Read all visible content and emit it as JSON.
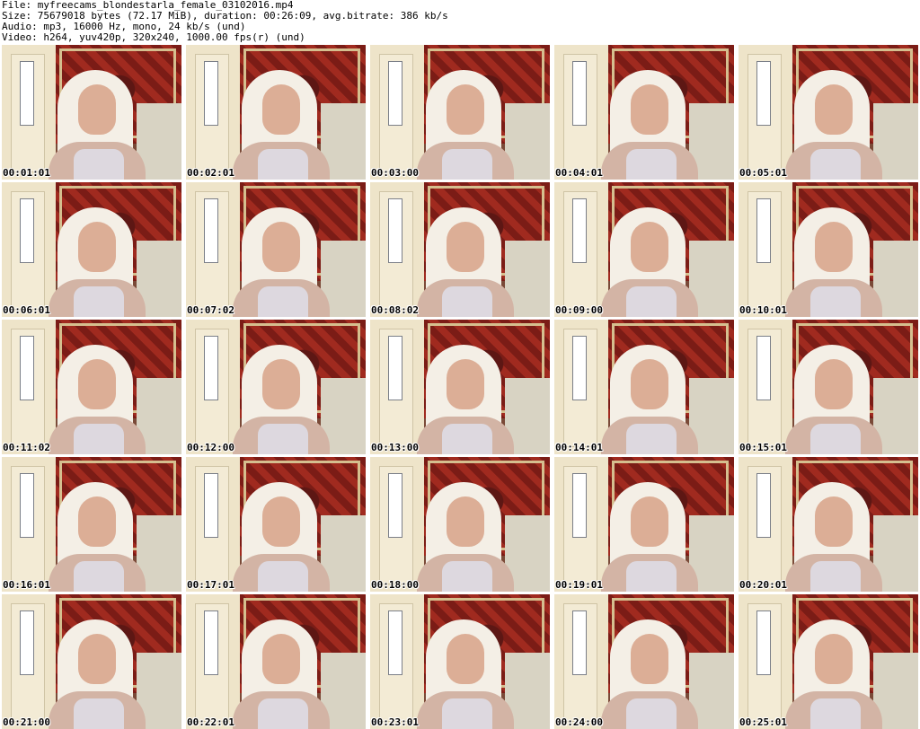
{
  "header": {
    "file": "File: myfreecams_blondestarla_female_03102016.mp4",
    "size": "Size: 75679018 bytes (72.17 MiB), duration: 00:26:09, avg.bitrate: 386 kb/s",
    "audio": "Audio: mp3, 16000 Hz, mono, 24 kb/s (und)",
    "video": "Video: h264, yuv420p, 320x240, 1000.00 fps(r) (und)"
  },
  "thumbnails": [
    {
      "timestamp": "00:01:01"
    },
    {
      "timestamp": "00:02:01"
    },
    {
      "timestamp": "00:03:00"
    },
    {
      "timestamp": "00:04:01"
    },
    {
      "timestamp": "00:05:01"
    },
    {
      "timestamp": "00:06:01"
    },
    {
      "timestamp": "00:07:02"
    },
    {
      "timestamp": "00:08:02"
    },
    {
      "timestamp": "00:09:00"
    },
    {
      "timestamp": "00:10:01"
    },
    {
      "timestamp": "00:11:02"
    },
    {
      "timestamp": "00:12:00"
    },
    {
      "timestamp": "00:13:00"
    },
    {
      "timestamp": "00:14:01"
    },
    {
      "timestamp": "00:15:01"
    },
    {
      "timestamp": "00:16:01"
    },
    {
      "timestamp": "00:17:01"
    },
    {
      "timestamp": "00:18:00"
    },
    {
      "timestamp": "00:19:01"
    },
    {
      "timestamp": "00:20:01"
    },
    {
      "timestamp": "00:21:00"
    },
    {
      "timestamp": "00:22:01"
    },
    {
      "timestamp": "00:23:01"
    },
    {
      "timestamp": "00:24:00"
    },
    {
      "timestamp": "00:25:01"
    }
  ]
}
